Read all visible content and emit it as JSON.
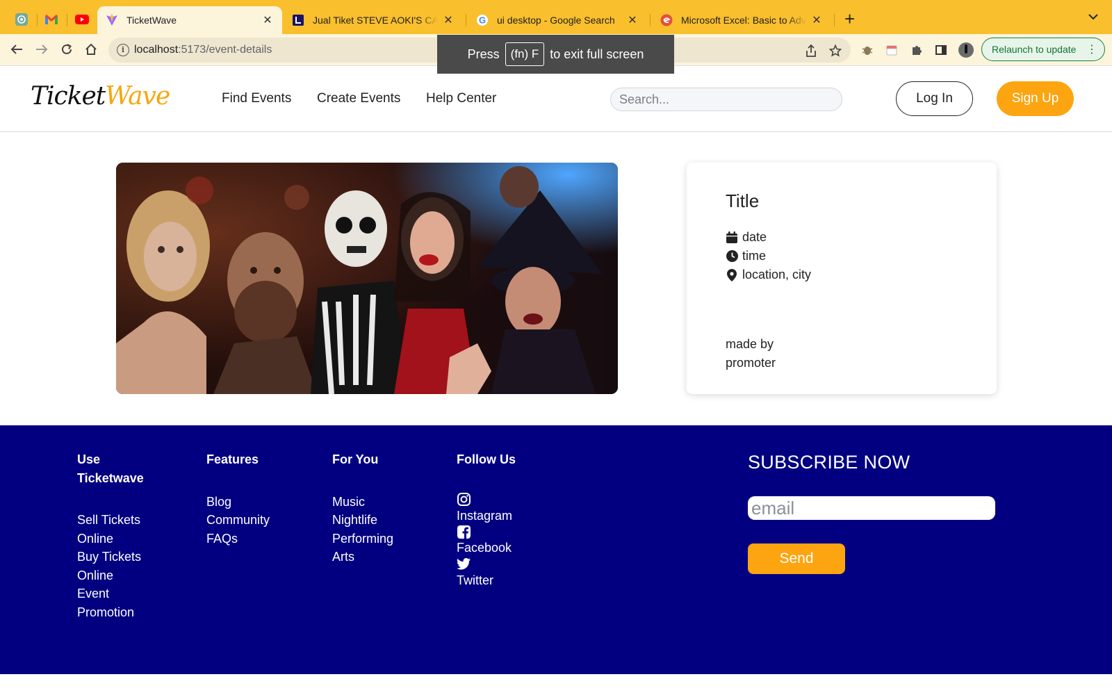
{
  "browser": {
    "pinned_tabs": [
      {
        "icon": "chatgpt-icon"
      },
      {
        "icon": "gmail-icon"
      },
      {
        "icon": "youtube-icon"
      }
    ],
    "tabs": [
      {
        "title": "TicketWave",
        "icon": "vite-icon",
        "active": true
      },
      {
        "title": "Jual Tiket STEVE AOKI'S CAKE",
        "icon": "loket-icon",
        "active": false
      },
      {
        "title": "ui desktop - Google Search",
        "icon": "google-icon",
        "active": false
      },
      {
        "title": "Microsoft Excel: Basic to Adva",
        "icon": "edu-icon",
        "active": false
      }
    ],
    "url_host": "localhost",
    "url_path": ":5173/event-details",
    "relaunch_label": "Relaunch to update",
    "fullscreen_toast": {
      "press": "Press",
      "key": "(fn) F",
      "suffix": "to exit full screen"
    },
    "tab_bar_color": "#f9bf2c"
  },
  "header": {
    "logo_part1": "Ticket",
    "logo_part2": "Wave",
    "nav": [
      "Find Events",
      "Create Events",
      "Help Center"
    ],
    "search_placeholder": "Search...",
    "login_label": "Log In",
    "signup_label": "Sign Up",
    "accent_color": "#fca510"
  },
  "event": {
    "image_alt": "Halloween costume party crowd",
    "title": "Title",
    "date": "date",
    "time": "time",
    "location": "location, city",
    "made_by": "made by",
    "promoter": "promoter"
  },
  "footer": {
    "background_color": "#020080",
    "columns": [
      {
        "heading": "Use Ticketwave",
        "links": [
          "Sell Tickets Online",
          "Buy Tickets Online",
          "Event Promotion"
        ]
      },
      {
        "heading": "Features",
        "links": [
          "Blog",
          "Community",
          "FAQs"
        ]
      },
      {
        "heading": "For You",
        "links": [
          "Music",
          "Nightlife",
          "Performing Arts"
        ]
      }
    ],
    "follow": {
      "heading": "Follow Us",
      "links": [
        {
          "label": "Instagram",
          "icon": "instagram-icon"
        },
        {
          "label": "Facebook",
          "icon": "facebook-icon"
        },
        {
          "label": "Twitter",
          "icon": "twitter-icon"
        }
      ]
    },
    "subscribe": {
      "title": "SUBSCRIBE NOW",
      "email_placeholder": "email",
      "send_label": "Send"
    }
  }
}
